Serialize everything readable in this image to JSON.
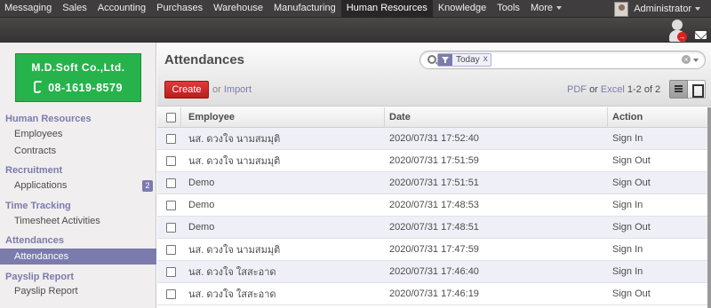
{
  "topbar": {
    "menu": [
      {
        "label": "Messaging",
        "active": false
      },
      {
        "label": "Sales",
        "active": false
      },
      {
        "label": "Accounting",
        "active": false
      },
      {
        "label": "Purchases",
        "active": false
      },
      {
        "label": "Warehouse",
        "active": false
      },
      {
        "label": "Manufacturing",
        "active": false
      },
      {
        "label": "Human Resources",
        "active": true
      },
      {
        "label": "Knowledge",
        "active": false
      },
      {
        "label": "Tools",
        "active": false
      },
      {
        "label": "More",
        "active": false
      }
    ],
    "user_name": "Administrator",
    "notification_count": "→"
  },
  "sidebar": {
    "logo_line1": "M.D.Soft Co.,Ltd.",
    "logo_line2": "08-1619-8579",
    "sections": [
      {
        "title": "Human Resources",
        "items": [
          {
            "label": "Employees"
          },
          {
            "label": "Contracts"
          }
        ]
      },
      {
        "title": "Recruitment",
        "items": [
          {
            "label": "Applications",
            "count": "2"
          }
        ]
      },
      {
        "title": "Time Tracking",
        "items": [
          {
            "label": "Timesheet Activities"
          }
        ]
      },
      {
        "title": "Attendances",
        "items": [
          {
            "label": "Attendances",
            "active": true
          }
        ]
      },
      {
        "title": "Payslip Report",
        "items": [
          {
            "label": "Payslip Report"
          }
        ]
      }
    ]
  },
  "main": {
    "title": "Attendances",
    "search": {
      "facet_value": "Today",
      "facet_remove": "x",
      "clear": "×"
    },
    "create_label": "Create",
    "or_text": "or",
    "import_label": "Import",
    "pdf_label": "PDF",
    "excel_label": "Excel",
    "pager": "1-2 of 2"
  },
  "table": {
    "columns": [
      "Employee",
      "Date",
      "Action"
    ],
    "rows": [
      {
        "employee": "นส. ดวงใจ นามสมมุติ",
        "date": "2020/07/31 17:52:40",
        "action": "Sign In"
      },
      {
        "employee": "นส. ดวงใจ นามสมมุติ",
        "date": "2020/07/31 17:51:59",
        "action": "Sign Out"
      },
      {
        "employee": "Demo",
        "date": "2020/07/31 17:51:51",
        "action": "Sign Out"
      },
      {
        "employee": "Demo",
        "date": "2020/07/31 17:48:53",
        "action": "Sign In"
      },
      {
        "employee": "Demo",
        "date": "2020/07/31 17:48:51",
        "action": "Sign Out"
      },
      {
        "employee": "นส. ดวงใจ นามสมมุติ",
        "date": "2020/07/31 17:47:59",
        "action": "Sign In"
      },
      {
        "employee": "นส. ดวงใจ ใสสะอาด",
        "date": "2020/07/31 17:46:40",
        "action": "Sign In"
      },
      {
        "employee": "นส. ดวงใจ ใสสะอาด",
        "date": "2020/07/31 17:46:19",
        "action": "Sign Out"
      }
    ]
  },
  "colors": {
    "accent": "#7c7bad",
    "create_button": "#c52828",
    "logo_green": "#26b34b",
    "topbar": "#3f3d3d"
  }
}
